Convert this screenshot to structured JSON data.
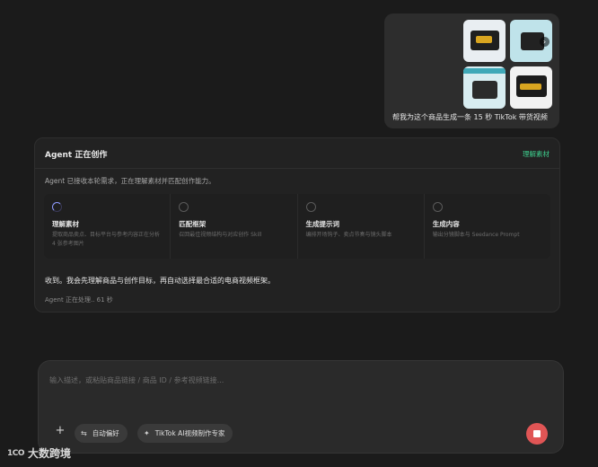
{
  "user_message": {
    "text": "帮我为这个商品生成一条 15 秒 TikTok 带货视频",
    "thumbnails": [
      "product-thumbnail",
      "product-thumbnail",
      "product-thumbnail",
      "product-thumbnail"
    ],
    "thumb_nav_icon": "arrow-right-icon"
  },
  "agent": {
    "title": "Agent 正在创作",
    "status": "理解素材",
    "status_color": "#3ecf8e",
    "description": "Agent 已接收本轮需求，正在理解素材并匹配创作能力。",
    "steps": [
      {
        "title": "理解素材",
        "subtitle": "提取商品卖点、目标平台与参考内容正在分析 4 张参考图片",
        "state": "active"
      },
      {
        "title": "匹配框架",
        "subtitle": "召回最佳视频结构与对应创作 Skill",
        "state": "pending"
      },
      {
        "title": "生成提示词",
        "subtitle": "编排开场钩子、卖点节奏与镜头脚本",
        "state": "pending"
      },
      {
        "title": "生成内容",
        "subtitle": "输出分镜脚本与 Seedance Prompt",
        "state": "pending"
      }
    ],
    "message": "收到。我会先理解商品与创作目标，再自动选择最合适的电商视频框架。",
    "processing": "Agent 正在处理.. 61 秒"
  },
  "composer": {
    "placeholder": "输入描述，或粘贴商品链接 / 商品 ID / 参考视频链接...",
    "value": "",
    "plus_label": "+",
    "chips": [
      {
        "label": "自动偏好",
        "icon": "sliders-icon"
      },
      {
        "label": "TikTok AI视频制作专家",
        "icon": "sparkle-icon"
      }
    ],
    "stop_color": "#e05555"
  },
  "watermark": {
    "logo": "1CO",
    "text": "大数跨境"
  }
}
